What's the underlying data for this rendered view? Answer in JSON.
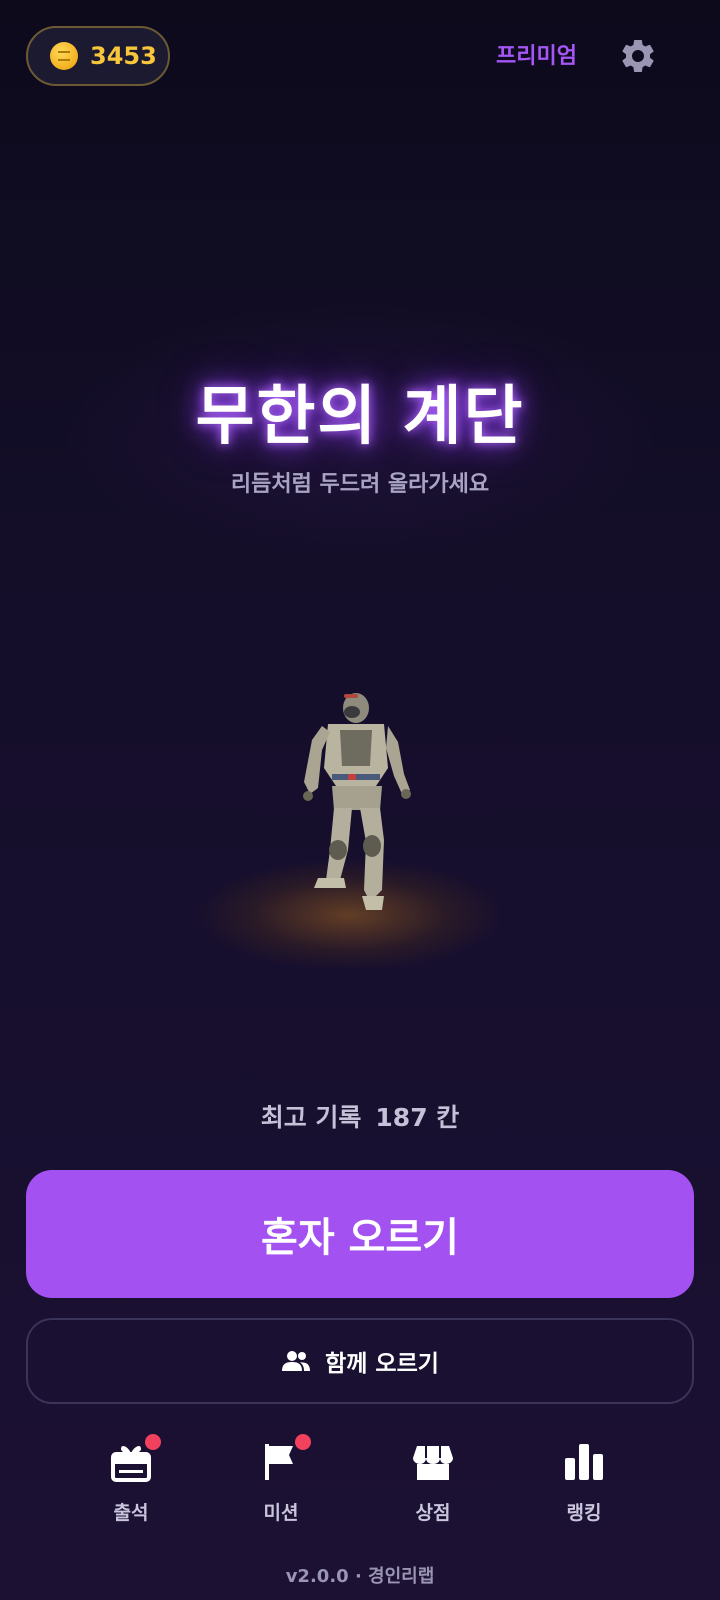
{
  "header": {
    "coin_count": "3453",
    "coin_icon": "coin-icon",
    "premium_label": "프리미엄",
    "settings_icon": "gear-icon"
  },
  "title": {
    "main": "무한의 계단",
    "subtitle": "리듬처럼 두드려 올라가세요"
  },
  "record": {
    "label": "최고 기록",
    "value": "187 칸"
  },
  "buttons": {
    "solo_label": "혼자 오르기",
    "multi_label": "함께 오르기",
    "multi_icon": "people-icon"
  },
  "nav": {
    "items": [
      {
        "label": "출석",
        "icon": "gift-icon",
        "badge": true
      },
      {
        "label": "미션",
        "icon": "flag-icon",
        "badge": true
      },
      {
        "label": "상점",
        "icon": "store-icon",
        "badge": false
      },
      {
        "label": "랭킹",
        "icon": "bar-chart-icon",
        "badge": false
      }
    ]
  },
  "footer": {
    "version": "v2.0.0 · 경인리랩"
  },
  "colors": {
    "accent": "#a451f2",
    "coin": "#f7c63a",
    "badge": "#f2415d",
    "background": "#140e29"
  }
}
